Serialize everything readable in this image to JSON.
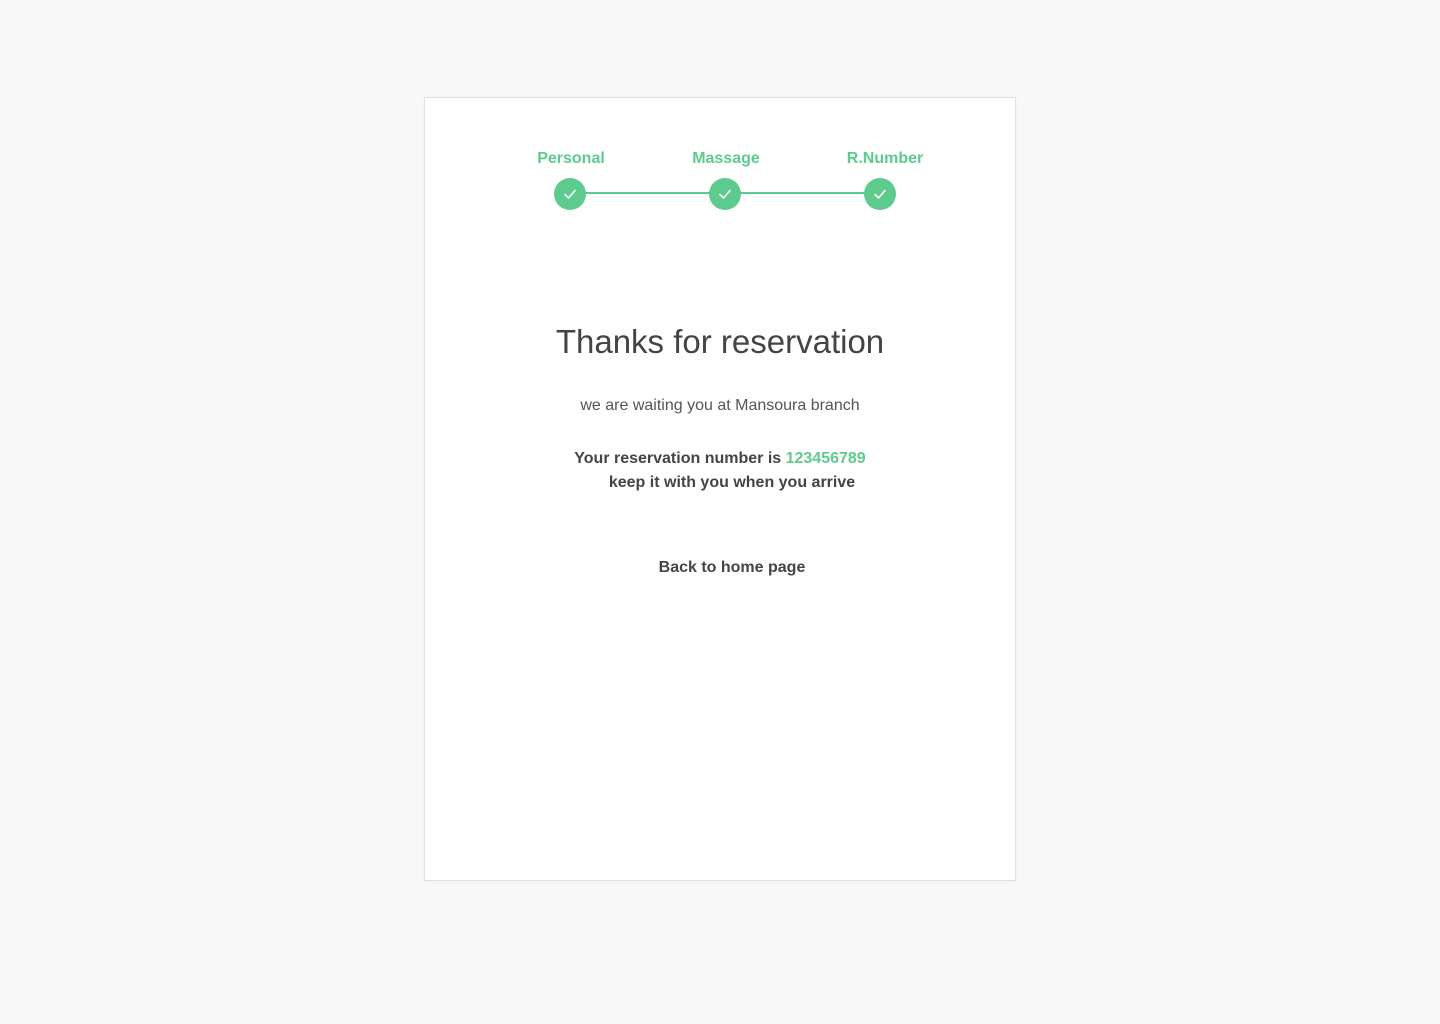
{
  "stepper": {
    "color": "#5ecb8e",
    "steps": [
      {
        "label": "Personal",
        "icon": "check-icon",
        "completed": true
      },
      {
        "label": "Massage",
        "icon": "check-icon",
        "completed": true
      },
      {
        "label": "R.Number",
        "icon": "check-icon",
        "completed": true
      }
    ]
  },
  "confirmation": {
    "title": "Thanks for reservation",
    "subtitle": "we are waiting you at Mansoura branch",
    "reservation_prefix": "Your reservation number is",
    "reservation_number": "123456789",
    "keep_note": "keep it with you when you arrive",
    "back_link": "Back to home page"
  }
}
